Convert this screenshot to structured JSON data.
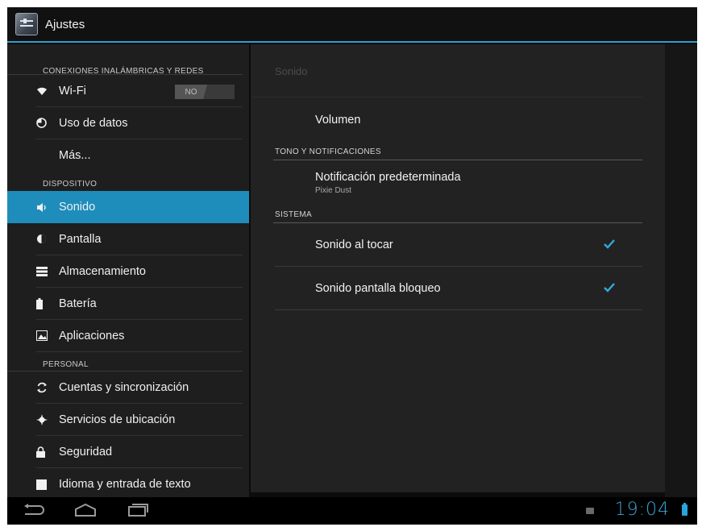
{
  "app": {
    "title": "Ajustes",
    "icon": "settings-app-icon"
  },
  "colors": {
    "accent": "#1f8dbb",
    "check": "#34a9dd",
    "clock": "#39a6d8"
  },
  "sidebar": {
    "sections": [
      {
        "header": "CONEXIONES INALÁMBRICAS Y REDES"
      },
      {
        "header": "DISPOSITIVO"
      },
      {
        "header": "PERSONAL"
      }
    ],
    "items": [
      {
        "label": "Wi-Fi",
        "icon": "wifi-icon",
        "toggle": "NO"
      },
      {
        "label": "Uso de datos",
        "icon": "data-usage-icon"
      },
      {
        "label": "Más..."
      },
      {
        "label": "Sonido",
        "icon": "speaker-icon",
        "selected": true
      },
      {
        "label": "Pantalla",
        "icon": "display-icon"
      },
      {
        "label": "Almacenamiento",
        "icon": "storage-icon"
      },
      {
        "label": "Batería",
        "icon": "battery-icon"
      },
      {
        "label": "Aplicaciones",
        "icon": "apps-icon"
      },
      {
        "label": "Cuentas y sincronización",
        "icon": "sync-icon"
      },
      {
        "label": "Servicios de ubicación",
        "icon": "location-icon"
      },
      {
        "label": "Seguridad",
        "icon": "lock-icon"
      },
      {
        "label": "Idioma y entrada de texto",
        "icon": "language-icon"
      }
    ]
  },
  "main": {
    "title": "Sonido",
    "volume_label": "Volumen",
    "section_ringtone": "TONO Y NOTIFICACIONES",
    "notification": {
      "label": "Notificación predeterminada",
      "value": "Pixie Dust"
    },
    "section_system": "SISTEMA",
    "touch_sound": {
      "label": "Sonido al tocar",
      "checked": true
    },
    "lock_sound": {
      "label": "Sonido pantalla bloqueo",
      "checked": true
    }
  },
  "statusbar": {
    "time": "19:04"
  }
}
